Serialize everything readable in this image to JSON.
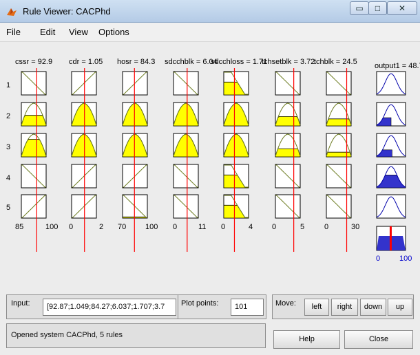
{
  "window": {
    "title": "Rule Viewer: CACPhd",
    "minimize_glyph": "▭",
    "maximize_glyph": "□",
    "close_glyph": "✕"
  },
  "menu": [
    "File",
    "Edit",
    "View",
    "Options"
  ],
  "inputs": [
    {
      "label": "cssr = 92.9",
      "range_min": "85",
      "range_max": "100",
      "marker": 0.62
    },
    {
      "label": "cdr = 1.05",
      "range_min": "0",
      "range_max": "2",
      "marker": 0.52
    },
    {
      "label": "hosr = 84.3",
      "range_min": "70",
      "range_max": "100",
      "marker": 0.48
    },
    {
      "label": "sdcchblk = 6.04",
      "range_min": "0",
      "range_max": "11",
      "marker": 0.55
    },
    {
      "label": "sdcchloss = 1.71",
      "range_min": "0",
      "range_max": "4",
      "marker": 0.43
    },
    {
      "label": "tchsetblk = 3.72",
      "range_min": "0",
      "range_max": "5",
      "marker": 0.74
    },
    {
      "label": "tchblk = 24.5",
      "range_min": "0",
      "range_max": "30",
      "marker": 0.82
    }
  ],
  "output": {
    "label": "output1 = 48.7",
    "range_min": "0",
    "range_max": "100",
    "value_fraction": 0.487
  },
  "rules": [
    "1",
    "2",
    "3",
    "4",
    "5"
  ],
  "bottom": {
    "input_label": "Input:",
    "input_value": "[92.87;1.049;84.27;6.037;1.707;3.7",
    "plot_points_label": "Plot points:",
    "plot_points_value": "101",
    "move_label": "Move:",
    "move_buttons": [
      "left",
      "right",
      "down",
      "up"
    ],
    "status": "Opened system CACPhd, 5 rules",
    "help_label": "Help",
    "close_label": "Close"
  },
  "colors": {
    "fill_input": "#ffff00",
    "fill_output": "#3333cc",
    "curve_input": "#6b7a1e",
    "curve_output": "#0000aa",
    "marker": "#ff0000",
    "defuzz_marker": "#ff0000",
    "axis_text_output": "#0000cc"
  }
}
